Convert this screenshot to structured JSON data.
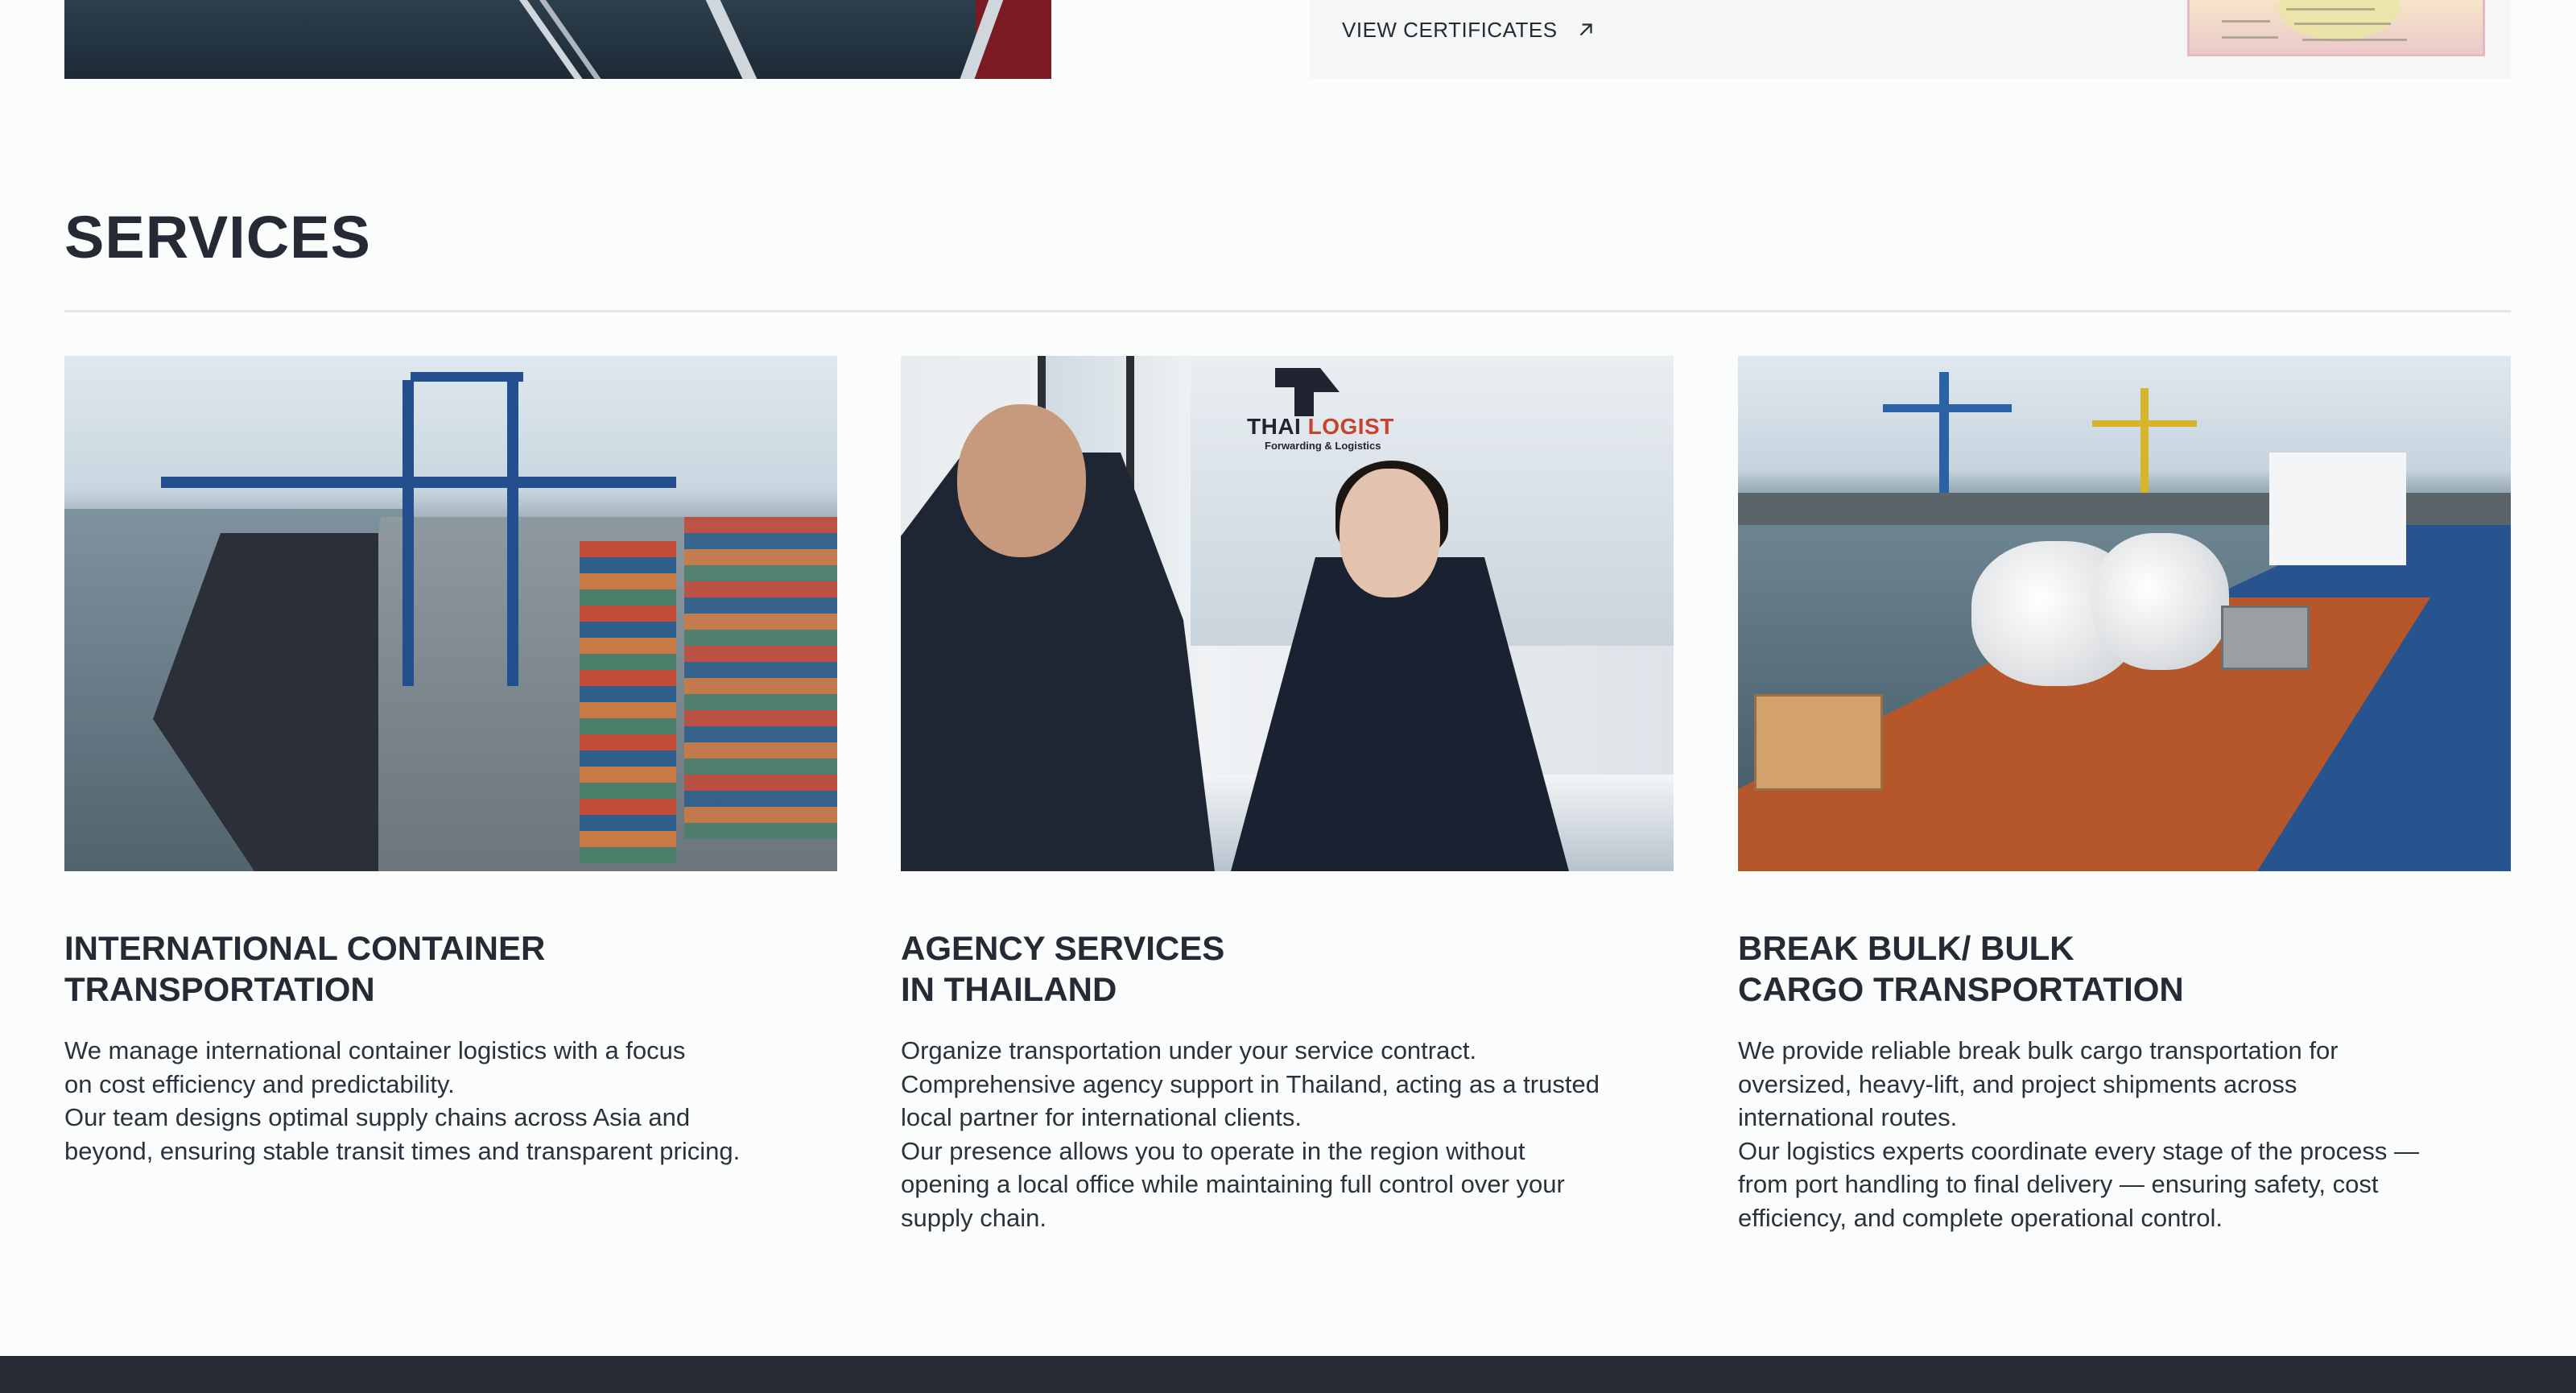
{
  "top": {
    "view_certificates_label": "VIEW CERTIFICATES"
  },
  "services": {
    "title": "SERVICES",
    "cards": [
      {
        "title_lines": [
          "INTERNATIONAL CONTAINER",
          "TRANSPORTATION"
        ],
        "text_lines": [
          "We manage international container logistics with a focus",
          "on cost efficiency and predictability.",
          "Our team designs optimal supply chains across Asia and",
          "beyond, ensuring stable transit times and transparent pricing."
        ]
      },
      {
        "title_lines": [
          "AGENCY SERVICES",
          "IN THAILAND"
        ],
        "text_lines": [
          "Organize transportation under your service contract.",
          "Comprehensive agency support in Thailand, acting as a trusted",
          "local partner for international clients.",
          "Our presence allows you to operate in the region without",
          "opening a local office while maintaining full control over your",
          "supply chain."
        ],
        "image_logo": {
          "word1": "THAI ",
          "word2": "LOGIST",
          "sub": "Forwarding & Logistics"
        }
      },
      {
        "title_lines": [
          "BREAK BULK/ BULK",
          "CARGO TRANSPORTATION"
        ],
        "text_lines": [
          "We provide reliable break bulk cargo transportation for",
          "oversized, heavy-lift, and project shipments across",
          "international routes.",
          "Our logistics experts coordinate every stage of the process —",
          "from port handling to final delivery — ensuring safety, cost",
          "efficiency, and complete operational control."
        ]
      }
    ]
  },
  "icons": {
    "external_link": "arrow-up-right-icon"
  },
  "colors": {
    "text_dark": "#252a35",
    "background": "#fbfcfc",
    "footer": "#252a35",
    "divider": "#e3e6e8"
  }
}
